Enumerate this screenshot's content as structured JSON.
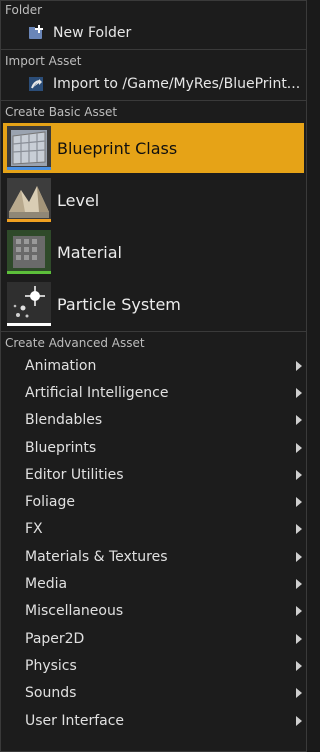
{
  "sections": {
    "folder": "Folder",
    "import": "Import Asset",
    "basic": "Create Basic Asset",
    "advanced": "Create Advanced Asset"
  },
  "folder_item": {
    "label": "New Folder",
    "icon": "new-folder-icon"
  },
  "import_item": {
    "label": "Import to /Game/MyRes/BluePrint...",
    "icon": "import-arrow-icon"
  },
  "basic_assets": [
    {
      "label": "Blueprint Class",
      "icon": "blueprint-class-icon",
      "accent": "#4a90e2",
      "selected": true
    },
    {
      "label": "Level",
      "icon": "level-terrain-icon",
      "accent": "#f0a020",
      "selected": false
    },
    {
      "label": "Material",
      "icon": "material-grid-icon",
      "accent": "#5cbf3a",
      "selected": false
    },
    {
      "label": "Particle System",
      "icon": "particle-sparkle-icon",
      "accent": "#ffffff",
      "selected": false
    }
  ],
  "advanced_assets": [
    {
      "label": "Animation"
    },
    {
      "label": "Artificial Intelligence"
    },
    {
      "label": "Blendables"
    },
    {
      "label": "Blueprints"
    },
    {
      "label": "Editor Utilities"
    },
    {
      "label": "Foliage"
    },
    {
      "label": "FX"
    },
    {
      "label": "Materials & Textures"
    },
    {
      "label": "Media"
    },
    {
      "label": "Miscellaneous"
    },
    {
      "label": "Paper2D"
    },
    {
      "label": "Physics"
    },
    {
      "label": "Sounds"
    },
    {
      "label": "User Interface"
    }
  ],
  "colors": {
    "selected_bg": "#e6a317",
    "menu_bg": "#1c1c1c",
    "separator": "#3a3a3a"
  }
}
